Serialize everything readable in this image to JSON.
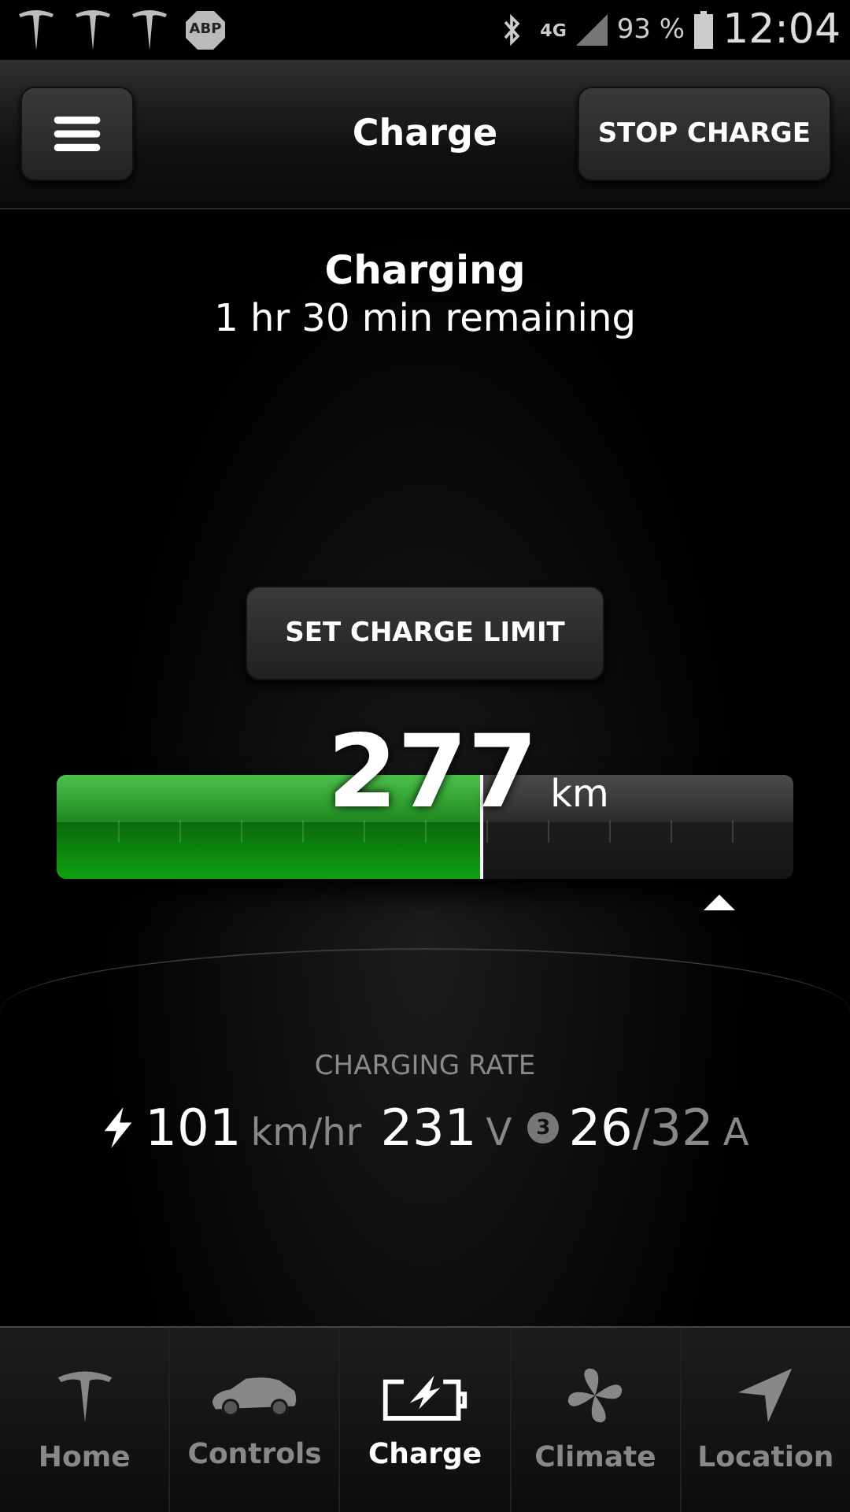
{
  "status_bar": {
    "notifications": [
      {
        "kind": "logo"
      },
      {
        "kind": "logo"
      },
      {
        "kind": "logo"
      },
      {
        "kind": "abp",
        "text": "ABP"
      }
    ],
    "network": "4G",
    "battery": "93 %",
    "time": "12:04"
  },
  "header": {
    "title": "Charge",
    "action": "STOP CHARGE"
  },
  "status": {
    "title": "Charging",
    "subtitle": "1 hr 30 min remaining"
  },
  "limit_button": "SET CHARGE LIMIT",
  "range": {
    "value": "277",
    "unit": "km",
    "level": 0.58
  },
  "rate": {
    "label": "CHARGING RATE",
    "speed": "101",
    "speed_unit": "km/hr",
    "voltage": "231",
    "voltage_unit": "V",
    "phases": "3",
    "current": "26",
    "max_current": "/32",
    "current_unit": "A"
  },
  "tabs": [
    {
      "label": "Home",
      "kind": "home",
      "selected": false
    },
    {
      "label": "Controls",
      "kind": "controls",
      "selected": false
    },
    {
      "label": "Charge",
      "kind": "charge",
      "selected": true
    },
    {
      "label": "Climate",
      "kind": "climate",
      "selected": false
    },
    {
      "label": "Location",
      "kind": "location",
      "selected": false
    }
  ]
}
